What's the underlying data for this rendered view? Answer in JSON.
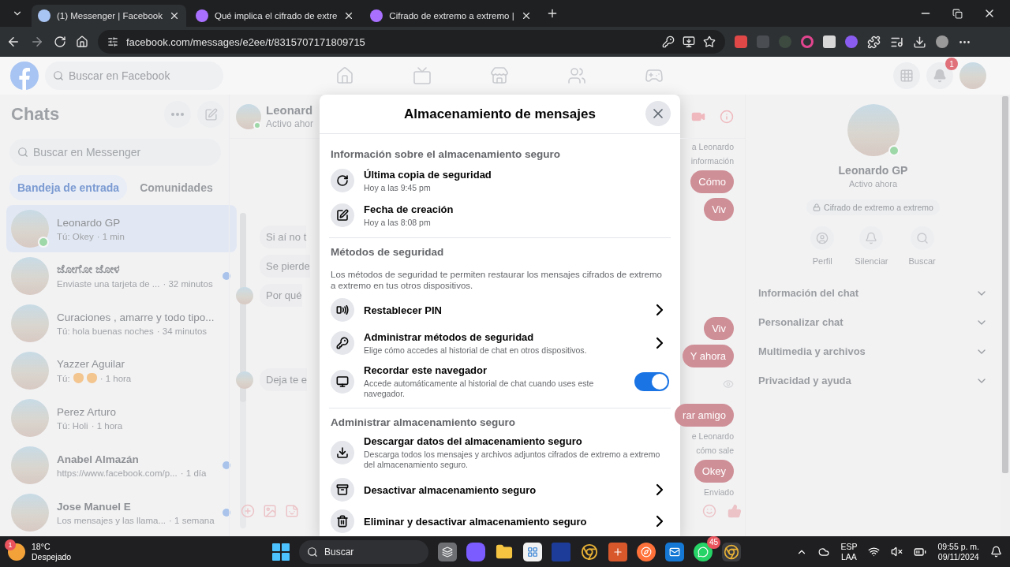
{
  "browser": {
    "tabs": [
      {
        "title": "(1) Messenger | Facebook",
        "selected": true
      },
      {
        "title": "Qué implica el cifrado de extre",
        "selected": false
      },
      {
        "title": "Cifrado de extremo a extremo |",
        "selected": false
      }
    ],
    "url": "facebook.com/messages/e2ee/t/8315707171809715"
  },
  "facebook": {
    "search_placeholder": "Buscar en Facebook",
    "notification_badge": "1"
  },
  "chats": {
    "title": "Chats",
    "search_placeholder": "Buscar en Messenger",
    "tabs": [
      {
        "label": "Bandeja de entrada",
        "selected": true
      },
      {
        "label": "Comunidades",
        "selected": false
      }
    ],
    "items": [
      {
        "kind": "text",
        "name": "Leonardo GP",
        "preview": "Tú: Okey",
        "time": "· 1 min",
        "selected": true,
        "online": true,
        "unread": false
      },
      {
        "kind": "text",
        "name": "ಜೋಗೋ ಜೋಳ",
        "preview": "Enviaste una tarjeta de ...",
        "time": "· 32 minutos",
        "selected": false,
        "online": false,
        "unread": true
      },
      {
        "kind": "text",
        "name": "Curaciones , amarre y todo tipo...",
        "preview": "Tú: hola buenas noches",
        "time": "· 34 minutos",
        "selected": false,
        "online": false,
        "unread": false
      },
      {
        "kind": "emoji",
        "name": "Yazzer Aguilar",
        "preview": "Tú:",
        "time": "· 1 hora",
        "selected": false,
        "online": false,
        "unread": false
      },
      {
        "kind": "text",
        "name": "Perez Arturo",
        "preview": "Tú: Holi",
        "time": "· 1 hora",
        "selected": false,
        "online": false,
        "unread": false
      },
      {
        "kind": "text",
        "name": "Anabel Almazán",
        "preview": "https://www.facebook.com/p...",
        "time": "· 1 día",
        "selected": false,
        "online": false,
        "unread": true
      },
      {
        "kind": "text",
        "name": "Jose Manuel E",
        "preview": "Los mensajes y las llama...",
        "time": "· 1 semana",
        "selected": false,
        "online": false,
        "unread": true
      }
    ]
  },
  "conversation": {
    "name": "Leonard",
    "status": "Activo ahor",
    "left_messages": [
      {
        "text": "Si aí no t",
        "avatar": false
      },
      {
        "text": "Se pierde",
        "avatar": false
      },
      {
        "text": "Por qué",
        "avatar": true
      },
      {
        "text": "Deja te e",
        "avatar": true
      }
    ],
    "right_top": [
      {
        "kind": "note",
        "text": "a Leonardo"
      },
      {
        "kind": "note",
        "text": "información"
      },
      {
        "kind": "bubble",
        "text": "Cómo"
      },
      {
        "kind": "bubble",
        "text": "Viv"
      }
    ],
    "right_bottom": [
      {
        "kind": "bubble",
        "text": "Viv"
      },
      {
        "kind": "bubble",
        "text": "Y ahora"
      },
      {
        "kind": "seen"
      },
      {
        "kind": "bubble",
        "text": "rar amigo"
      },
      {
        "kind": "note",
        "text": "e Leonardo"
      },
      {
        "kind": "note",
        "text": "cómo sale"
      },
      {
        "kind": "bubble",
        "text": "Okey"
      },
      {
        "kind": "note",
        "text": "Enviado"
      }
    ]
  },
  "contact": {
    "name": "Leonardo GP",
    "status": "Activo ahora",
    "online": true,
    "encryption": "Cifrado de extremo a extremo",
    "actions": [
      "Perfil",
      "Silenciar",
      "Buscar"
    ],
    "sections": [
      {
        "label": "Información del chat",
        "expanded": false
      },
      {
        "label": "Personalizar chat",
        "expanded": false
      },
      {
        "label": "Multimedia y archivos",
        "expanded": false
      },
      {
        "label": "Privacidad y ayuda",
        "expanded": false
      }
    ]
  },
  "modal": {
    "title": "Almacenamiento de mensajes",
    "sections": [
      {
        "heading": "Información sobre el almacenamiento seguro",
        "rows": [
          {
            "kind": "info",
            "title": "Última copia de seguridad",
            "subtitle": "Hoy a las 9:45 pm"
          },
          {
            "kind": "info",
            "title": "Fecha de creación",
            "subtitle": "Hoy a las 8:08 pm"
          }
        ]
      },
      {
        "heading": "Métodos de seguridad",
        "description": "Los métodos de seguridad te permiten restaurar los mensajes cifrados de extremo a extremo en tus otros dispositivos.",
        "rows": [
          {
            "kind": "link",
            "title": "Restablecer PIN"
          },
          {
            "kind": "link",
            "title": "Administrar métodos de seguridad",
            "subtitle": "Elige cómo accedes al historial de chat en otros dispositivos."
          },
          {
            "kind": "toggle",
            "title": "Recordar este navegador",
            "subtitle": "Accede automáticamente al historial de chat cuando uses este navegador.",
            "on": true
          }
        ]
      },
      {
        "heading": "Administrar almacenamiento seguro",
        "rows": [
          {
            "kind": "info",
            "title": "Descargar datos del almacenamiento seguro",
            "subtitle": "Descarga todos los mensajes y archivos adjuntos cifrados de extremo a extremo del almacenamiento seguro."
          },
          {
            "kind": "link",
            "title": "Desactivar almacenamiento seguro"
          },
          {
            "kind": "link",
            "title": "Eliminar y desactivar almacenamiento seguro"
          }
        ]
      }
    ]
  },
  "taskbar": {
    "weather_badge": "1",
    "temperature": "18°C",
    "condition": "Despejado",
    "search_label": "Buscar",
    "whatsapp_badge": "45",
    "language": "ESP",
    "layout": "LAA",
    "time": "09:55 p. m.",
    "date": "09/11/2024"
  }
}
